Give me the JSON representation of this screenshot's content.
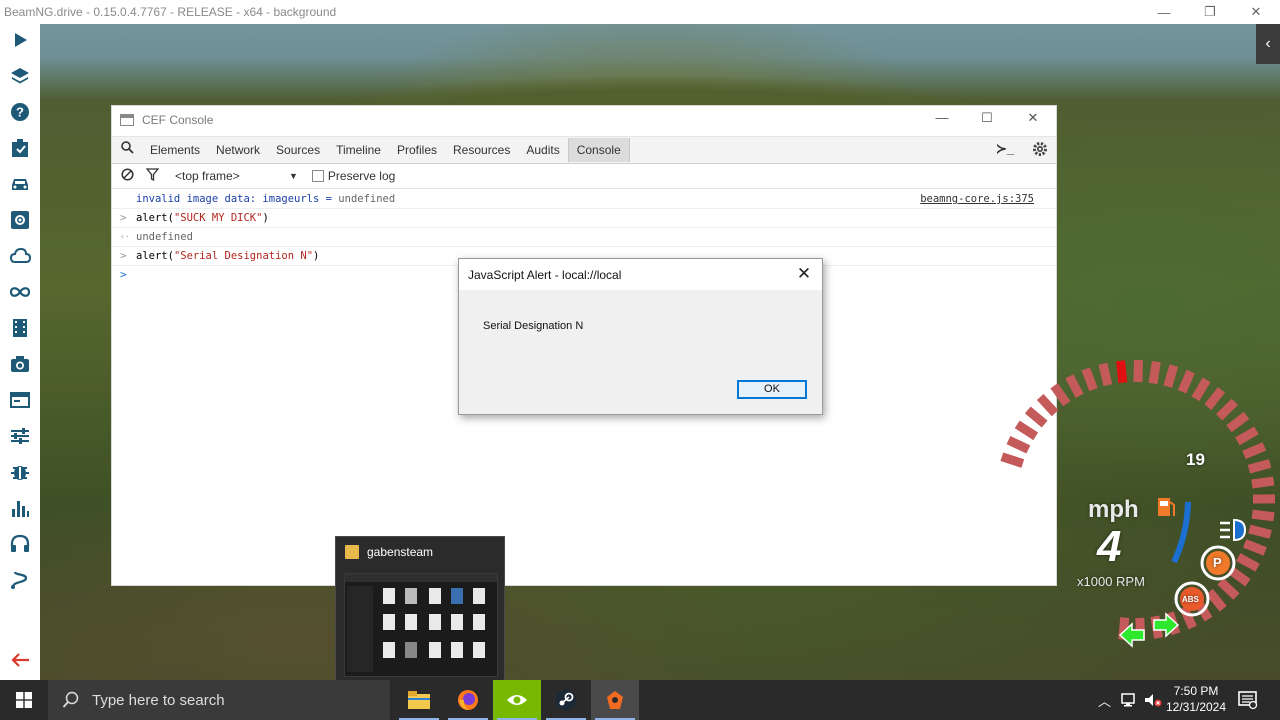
{
  "window": {
    "title": "BeamNG.drive - 0.15.0.4.7767 - RELEASE - x64 - background",
    "controls": [
      "—",
      "❐",
      "✕"
    ]
  },
  "sidebar": {
    "icons": [
      "play-icon",
      "layers-icon",
      "help-icon",
      "clipboard-icon",
      "car-icon",
      "settings-box-icon",
      "cloud-icon",
      "infinity-icon",
      "film-icon",
      "camera-icon",
      "window-icon",
      "sliders-icon",
      "bug-icon",
      "bar-chart-icon",
      "headset-icon",
      "route-icon",
      "back-arrow-icon"
    ],
    "accent": "#1e5a78",
    "back_color": "#d93a2b"
  },
  "right_panel_toggle": "‹",
  "cef_console": {
    "title": "CEF Console",
    "controls": [
      "—",
      "☐",
      "✕"
    ],
    "tabs": [
      "Elements",
      "Network",
      "Sources",
      "Timeline",
      "Profiles",
      "Resources",
      "Audits",
      "Console"
    ],
    "active_tab": "Console",
    "terminal_glyph": "≻_",
    "frame_select": "<top frame>",
    "preserve_log_label": "Preserve log",
    "lines": [
      {
        "prefix": "",
        "text_a": "invalid image data: imageurls = ",
        "text_b": "undefined",
        "source": "beamng-core.js:375"
      },
      {
        "prefix": ">",
        "text_a": "alert(",
        "text_b": "\"SUCK MY DICK\"",
        "text_c": ")"
      },
      {
        "prefix": "‹·",
        "text_a": "undefined"
      },
      {
        "prefix": ">",
        "text_a": "alert(",
        "text_b": "\"Serial Designation N\"",
        "text_c": ")"
      },
      {
        "prefix": ">",
        "text_a": ""
      }
    ]
  },
  "alert": {
    "title": "JavaScript Alert - local://local",
    "close": "✕",
    "message": "Serial Designation N",
    "ok_label": "OK"
  },
  "hud": {
    "gear_number": "19",
    "speed_unit": "mph",
    "gear": "4",
    "rpm_unit": "x1000 RPM",
    "park_badge": "P",
    "abs_badge": "ABS",
    "speed_fraction": 0.02,
    "colors": {
      "arc": "#c45a5a",
      "redline": "#e01010",
      "fuel": "#f07a2a",
      "blue_arc": "#1b6fd1",
      "green": "#2ee82e"
    }
  },
  "taskbar_preview": {
    "title": "gabensteam"
  },
  "taskbar": {
    "search_placeholder": "Type here to search",
    "apps": [
      "file-explorer-icon",
      "firefox-icon",
      "nvidia-icon",
      "steam-icon",
      "beamng-icon"
    ],
    "active_app": "beamng-icon",
    "clock_time": "7:50 PM",
    "clock_date": "12/31/2024"
  }
}
